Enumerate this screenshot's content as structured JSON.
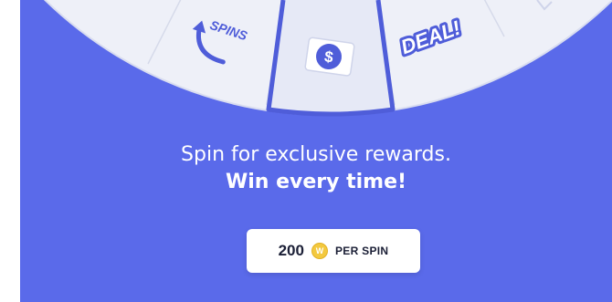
{
  "wheel": {
    "segments": [
      {
        "label": "SPINS",
        "icon": "spins-arrow-icon"
      },
      {
        "label": "$",
        "icon": "dollar-bill-icon"
      },
      {
        "label": "DEAL!",
        "icon": "deal-sticker-icon"
      }
    ]
  },
  "tagline": {
    "line1": "Spin for exclusive rewards.",
    "line2": "Win every time!"
  },
  "spin_button": {
    "amount": "200",
    "coin_symbol": "W",
    "per_label": "PER SPIN"
  },
  "colors": {
    "background": "#5a6aea",
    "wheel_face": "#eef0f8",
    "accent": "#4f5dd9",
    "coin": "#f3c93f"
  }
}
